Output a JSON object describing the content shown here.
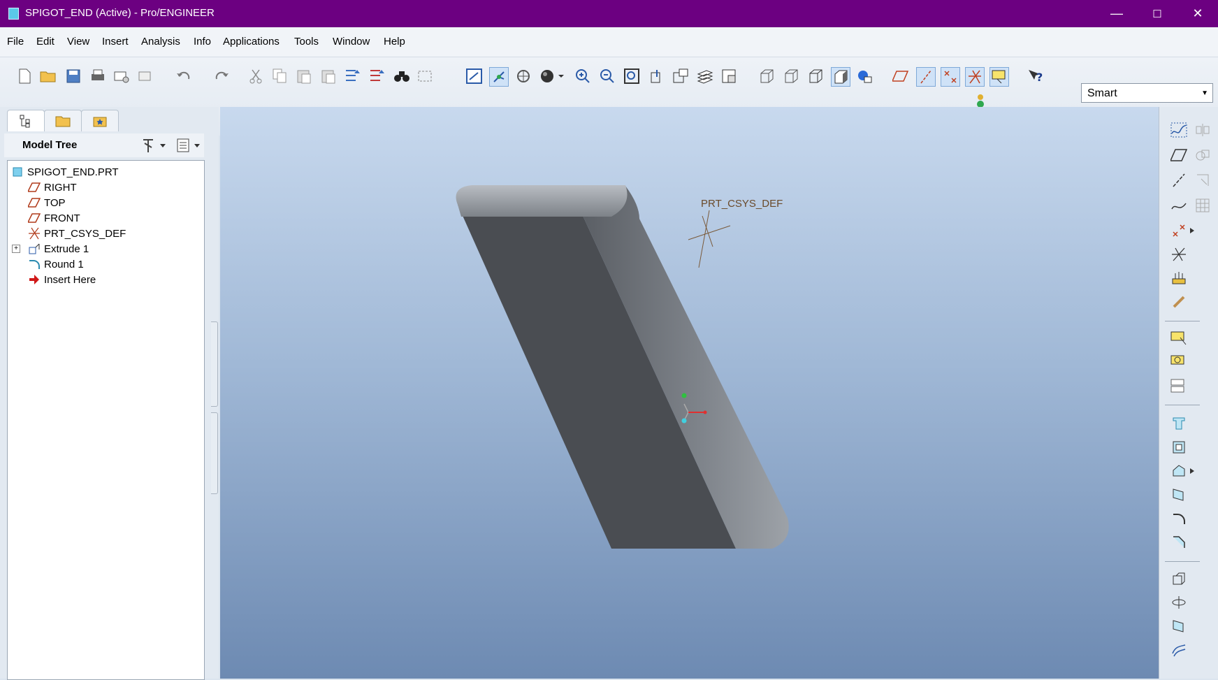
{
  "window": {
    "title": "SPIGOT_END (Active) - Pro/ENGINEER",
    "minimize": "—",
    "maximize": "☐",
    "close": "✕"
  },
  "menu": [
    "File",
    "Edit",
    "View",
    "Insert",
    "Analysis",
    "Info",
    "Applications",
    "Tools",
    "Window",
    "Help"
  ],
  "filter": {
    "selected": "Smart"
  },
  "model_tree": {
    "title": "Model Tree",
    "items": [
      {
        "label": "SPIGOT_END.PRT",
        "icon": "part-icon"
      },
      {
        "label": "RIGHT",
        "icon": "datum-plane-icon"
      },
      {
        "label": "TOP",
        "icon": "datum-plane-icon"
      },
      {
        "label": "FRONT",
        "icon": "datum-plane-icon"
      },
      {
        "label": "PRT_CSYS_DEF",
        "icon": "csys-icon"
      },
      {
        "label": "Extrude 1",
        "icon": "extrude-icon"
      },
      {
        "label": "Round 1",
        "icon": "round-icon"
      },
      {
        "label": "Insert Here",
        "icon": "insert-arrow-icon"
      }
    ]
  },
  "viewport": {
    "csys_label": "PRT_CSYS_DEF"
  },
  "colors": {
    "titlebar": "#6c0081",
    "model": "#4a4d52",
    "viewport_top": "#c8d9ee",
    "viewport_bottom": "#6d8ab2"
  }
}
